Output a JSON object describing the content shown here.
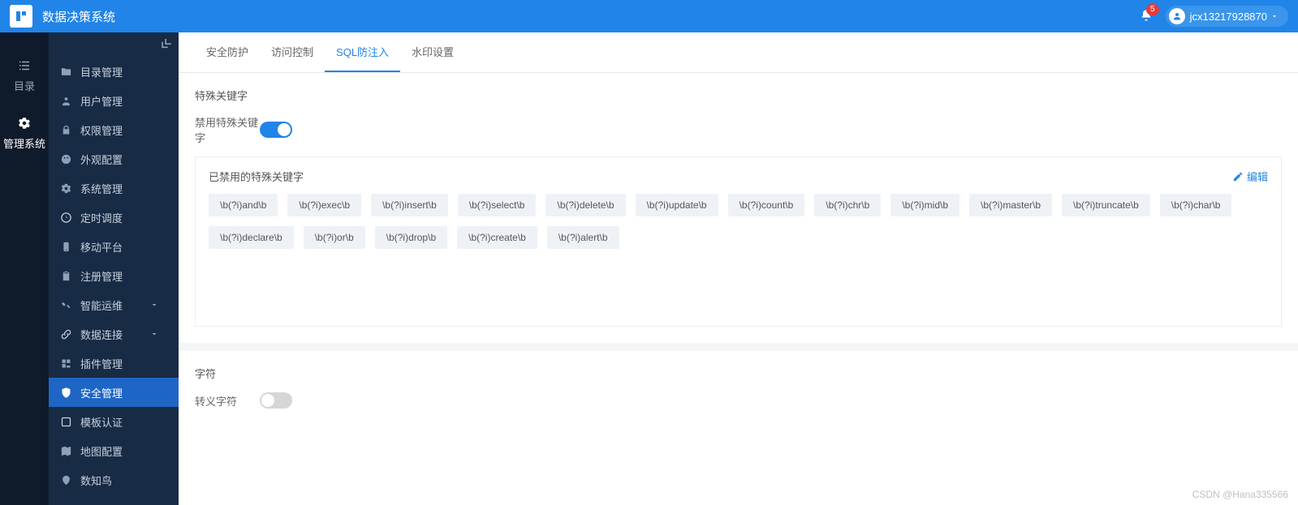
{
  "topbar": {
    "app_title": "数据决策系统",
    "notification_count": "5",
    "username": "jcx13217928870"
  },
  "rail": {
    "items": [
      {
        "label": "目录"
      },
      {
        "label": "管理系统"
      }
    ]
  },
  "sidebar": {
    "items": [
      {
        "icon": "folder",
        "label": "目录管理",
        "expand": false,
        "active": false
      },
      {
        "icon": "user",
        "label": "用户管理",
        "expand": false,
        "active": false
      },
      {
        "icon": "lock",
        "label": "权限管理",
        "expand": false,
        "active": false
      },
      {
        "icon": "palette",
        "label": "外观配置",
        "expand": false,
        "active": false
      },
      {
        "icon": "gear",
        "label": "系统管理",
        "expand": false,
        "active": false
      },
      {
        "icon": "clock",
        "label": "定时调度",
        "expand": false,
        "active": false
      },
      {
        "icon": "mobile",
        "label": "移动平台",
        "expand": false,
        "active": false
      },
      {
        "icon": "clipboard",
        "label": "注册管理",
        "expand": false,
        "active": false
      },
      {
        "icon": "tools",
        "label": "智能运维",
        "expand": true,
        "active": false
      },
      {
        "icon": "link",
        "label": "数据连接",
        "expand": true,
        "active": false
      },
      {
        "icon": "plugin",
        "label": "插件管理",
        "expand": false,
        "active": false
      },
      {
        "icon": "shield",
        "label": "安全管理",
        "expand": false,
        "active": true
      },
      {
        "icon": "template",
        "label": "模板认证",
        "expand": false,
        "active": false
      },
      {
        "icon": "map",
        "label": "地图配置",
        "expand": false,
        "active": false
      },
      {
        "icon": "bird",
        "label": "数知鸟",
        "expand": false,
        "active": false
      }
    ]
  },
  "tabs": {
    "items": [
      {
        "label": "安全防护",
        "active": false
      },
      {
        "label": "访问控制",
        "active": false
      },
      {
        "label": "SQL防注入",
        "active": true
      },
      {
        "label": "水印设置",
        "active": false
      }
    ]
  },
  "section1": {
    "title": "特殊关键字",
    "toggle_label": "禁用特殊关键字",
    "toggle_on": true,
    "panel_title": "已禁用的特殊关键字",
    "edit_label": "编辑",
    "keywords": [
      "\\b(?i)and\\b",
      "\\b(?i)exec\\b",
      "\\b(?i)insert\\b",
      "\\b(?i)select\\b",
      "\\b(?i)delete\\b",
      "\\b(?i)update\\b",
      "\\b(?i)count\\b",
      "\\b(?i)chr\\b",
      "\\b(?i)mid\\b",
      "\\b(?i)master\\b",
      "\\b(?i)truncate\\b",
      "\\b(?i)char\\b",
      "\\b(?i)declare\\b",
      "\\b(?i)or\\b",
      "\\b(?i)drop\\b",
      "\\b(?i)create\\b",
      "\\b(?i)alert\\b"
    ]
  },
  "section2": {
    "title": "字符",
    "toggle_label": "转义字符",
    "toggle_on": false
  },
  "watermark": "CSDN @Hana335566"
}
